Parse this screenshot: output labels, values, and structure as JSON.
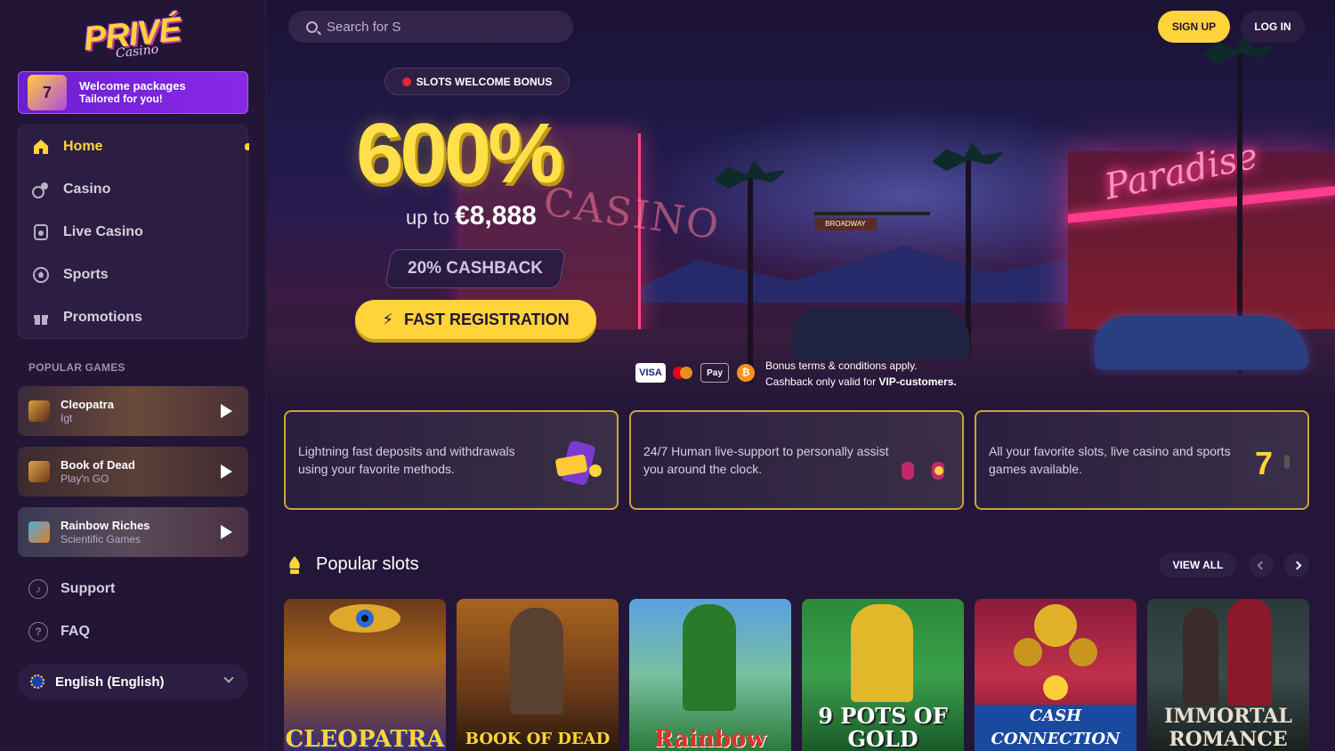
{
  "brand": {
    "logo_text": "PRIVÉ",
    "logo_sub": "Casino"
  },
  "welcome": {
    "line1": "Welcome packages",
    "line2": "Tailored for you!"
  },
  "nav": [
    {
      "label": "Home",
      "icon": "home-icon",
      "active": true
    },
    {
      "label": "Casino",
      "icon": "casino-chip-icon"
    },
    {
      "label": "Live Casino",
      "icon": "live-casino-icon"
    },
    {
      "label": "Sports",
      "icon": "soccer-ball-icon"
    },
    {
      "label": "Promotions",
      "icon": "gift-icon"
    }
  ],
  "popular_games": {
    "title": "POPULAR GAMES",
    "items": [
      {
        "name": "Cleopatra",
        "provider": "Igt"
      },
      {
        "name": "Book of Dead",
        "provider": "Play'n GO"
      },
      {
        "name": "Rainbow Riches",
        "provider": "Scientific Games"
      }
    ]
  },
  "links": {
    "support": "Support",
    "faq": "FAQ"
  },
  "language": {
    "label": "English (English)"
  },
  "search": {
    "placeholder": "Search for S"
  },
  "header": {
    "signup": "SIGN UP",
    "login": "LOG IN"
  },
  "hero": {
    "tag": "SLOTS WELCOME BONUS",
    "percent": "600%",
    "upto_prefix": "up to",
    "upto_amount": "€8,888",
    "cashback": "20% CASHBACK",
    "cta": "FAST REGISTRATION",
    "payments": [
      "VISA",
      "Mastercard",
      "Apple Pay",
      "Bitcoin"
    ],
    "terms_line1": "Bonus terms & conditions apply.",
    "terms_line2_prefix": "Cashback only valid for",
    "terms_line2_bold": "VIP-customers.",
    "scene_signs": {
      "casino": "CASINO",
      "paradise": "Paradise",
      "street": "BROADWAY"
    }
  },
  "features": [
    {
      "text": "Lightning fast deposits and withdrawals using your favorite methods.",
      "icon": "wallet-phone-icon"
    },
    {
      "text": "24/7 Human live-support to personally assist you around the clock.",
      "icon": "headset-icon"
    },
    {
      "text": "All your favorite slots, live casino and sports games available.",
      "icon": "slot-seven-icon"
    }
  ],
  "popular_slots": {
    "title": "Popular slots",
    "view_all": "VIEW ALL",
    "tiles": [
      {
        "title": "CLEOPATRA"
      },
      {
        "title": "BOOK OF DEAD"
      },
      {
        "title": "Rainbow"
      },
      {
        "title": "9 POTS OF GOLD"
      },
      {
        "title": "CASH CONNECTION"
      },
      {
        "title": "IMMORTAL ROMANCE"
      }
    ]
  }
}
